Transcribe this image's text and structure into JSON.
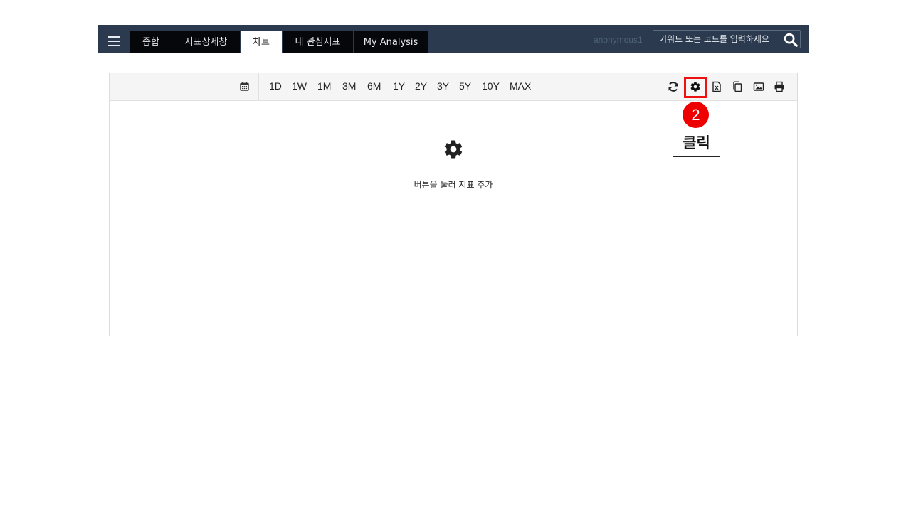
{
  "header": {
    "tabs": [
      {
        "label": "종합",
        "active": false
      },
      {
        "label": "지표상세창",
        "active": false
      },
      {
        "label": "차트",
        "active": true
      },
      {
        "label": "내 관심지표",
        "active": false
      },
      {
        "label": "My Analysis",
        "active": false
      }
    ],
    "user": "anonymous1",
    "search_placeholder": "키워드 또는 코드를 입력하세요"
  },
  "toolbar": {
    "ranges": [
      "1D",
      "1W",
      "1M",
      "3M",
      "6M",
      "1Y",
      "2Y",
      "3Y",
      "5Y",
      "10Y",
      "MAX"
    ]
  },
  "annotation": {
    "step": "2",
    "label": "클릭",
    "color": "#ee0000"
  },
  "chart": {
    "empty_hint": "버튼을 눌러 지표 추가"
  },
  "icons": [
    "menu-icon",
    "search-icon",
    "calendar-icon",
    "refresh-icon",
    "gear-icon",
    "excel-icon",
    "copy-icon",
    "image-icon",
    "print-icon"
  ]
}
